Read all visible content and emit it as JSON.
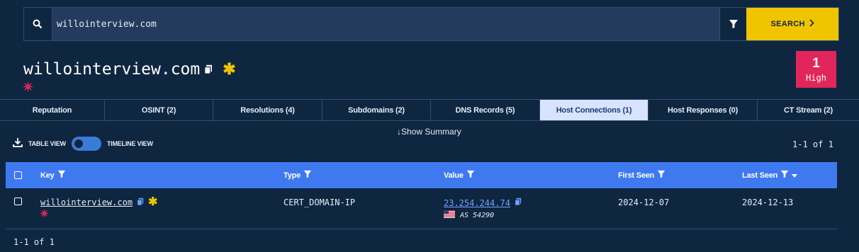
{
  "search": {
    "value": "willointerview.com",
    "placeholder": "",
    "button_label": "SEARCH"
  },
  "entity": {
    "title": "willointerview.com",
    "score": "1",
    "score_label": "High"
  },
  "tabs": [
    {
      "label": "Reputation"
    },
    {
      "label": "OSINT (2)"
    },
    {
      "label": "Resolutions (4)"
    },
    {
      "label": "Subdomains (2)"
    },
    {
      "label": "DNS Records (5)"
    },
    {
      "label": "Host Connections (1)",
      "active": true
    },
    {
      "label": "Host Responses (0)"
    },
    {
      "label": "CT Stream (2)"
    }
  ],
  "summary_label": "Show Summary",
  "view": {
    "table_label": "TABLE VIEW",
    "timeline_label": "TIMELINE VIEW"
  },
  "pagination": {
    "top": "1-1 of 1",
    "bottom": "1-1 of 1"
  },
  "table": {
    "headers": {
      "key": "Key",
      "type": "Type",
      "value": "Value",
      "first_seen": "First Seen",
      "last_seen": "Last Seen"
    },
    "rows": [
      {
        "key": "willointerview.com",
        "type": "CERT_DOMAIN-IP",
        "value": "23.254.244.74",
        "asn": "AS 54290",
        "first_seen": "2024-12-07",
        "last_seen": "2024-12-13"
      }
    ]
  },
  "colors": {
    "background": "#0f2640",
    "accent": "#f0c400",
    "header_blue": "#3e79ef",
    "score_red": "#e0265a",
    "active_tab": "#d8e3ff"
  },
  "icons": [
    "search-icon",
    "filter-icon",
    "chevron-right-icon",
    "copy-icon",
    "star-icon",
    "malicious-badge-icon",
    "download-icon",
    "arrow-down-icon",
    "sort-desc-icon",
    "us-flag-icon"
  ]
}
